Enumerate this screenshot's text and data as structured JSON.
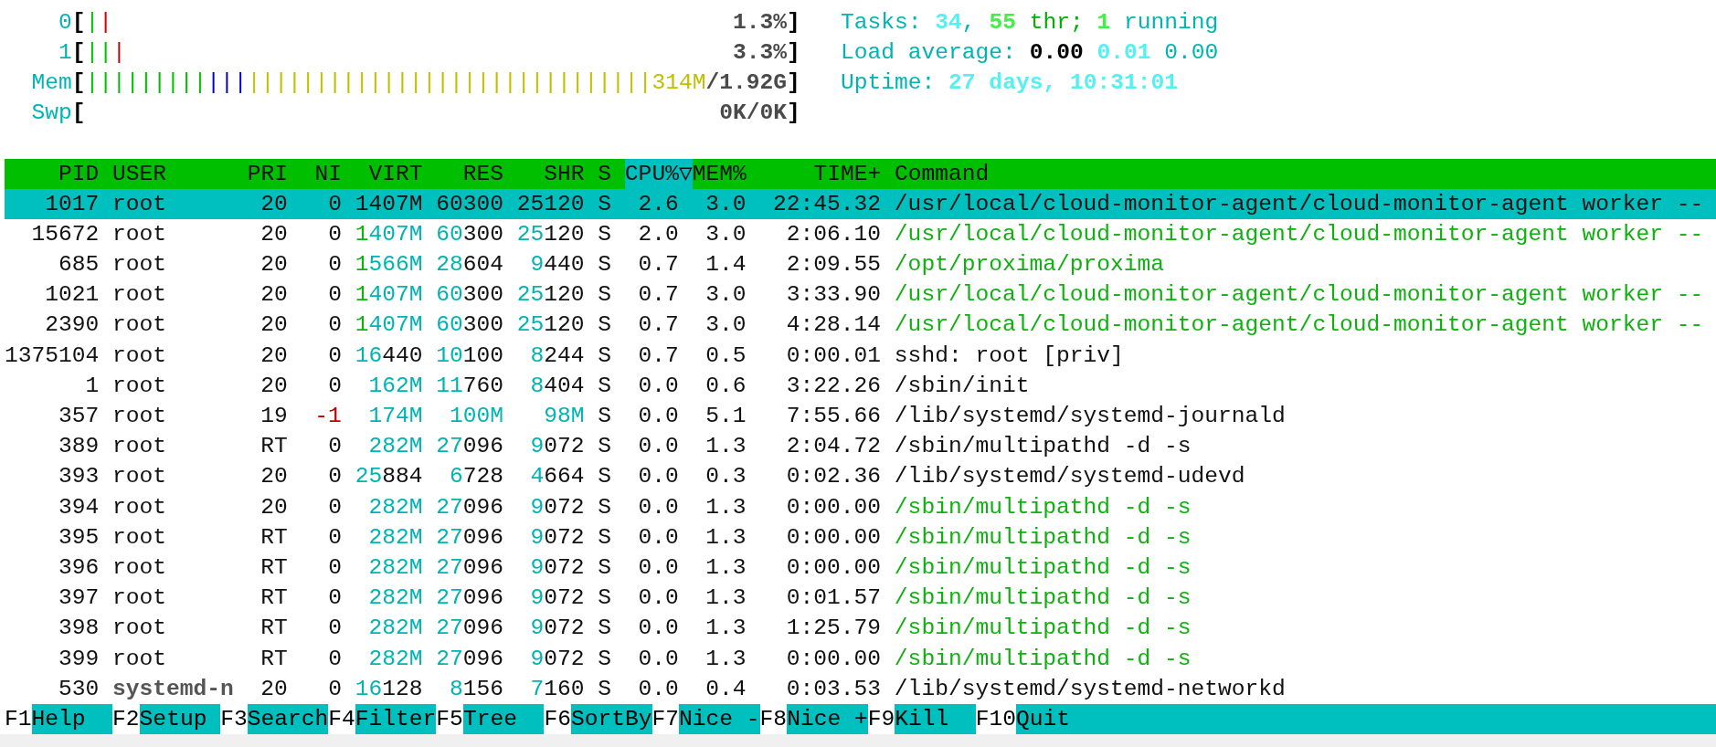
{
  "meters": [
    {
      "label": "0",
      "open": "[",
      "close": "]",
      "segments": [
        {
          "text": "|",
          "color": "#00c000"
        },
        {
          "text": "|",
          "color": "#d00000"
        }
      ],
      "value": "1.3%"
    },
    {
      "label": "1",
      "open": "[",
      "close": "]",
      "segments": [
        {
          "text": "||",
          "color": "#00c000"
        },
        {
          "text": "|",
          "color": "#d00000"
        }
      ],
      "value": "3.3%"
    },
    {
      "label": "Mem",
      "open": "[",
      "close": "]",
      "segments": [
        {
          "text": "|||||||||",
          "color": "#00c000"
        },
        {
          "text": "|||",
          "color": "#0000d0"
        },
        {
          "text": "||||||||||||||||||||||||||||||",
          "color": "#c0c000"
        }
      ],
      "value_used": "314M",
      "value": "/1.92G"
    },
    {
      "label": "Swp",
      "open": "[",
      "close": "]",
      "value": "0K/0K"
    }
  ],
  "summary": [
    [
      {
        "text": "Tasks: ",
        "color": "#00b4b4",
        "bold": false
      },
      {
        "text": "34",
        "color": "#55f0f0",
        "bold": true
      },
      {
        "text": ", ",
        "color": "#00b4b4",
        "bold": false
      },
      {
        "text": "55",
        "color": "#44ee44",
        "bold": true
      },
      {
        "text": " thr;",
        "color": "#00b000",
        "bold": false
      },
      {
        "text": " 1",
        "color": "#44ee44",
        "bold": true
      },
      {
        "text": " running",
        "color": "#00b4b4",
        "bold": false
      }
    ],
    [
      {
        "text": "Load average: ",
        "color": "#00b4b4",
        "bold": false
      },
      {
        "text": "0.00",
        "color": "#000000",
        "bold": true
      },
      {
        "text": " 0.01",
        "color": "#55f0f0",
        "bold": true
      },
      {
        "text": " 0.00",
        "color": "#00b4b4",
        "bold": false
      }
    ],
    [
      {
        "text": "Uptime: ",
        "color": "#00b4b4",
        "bold": false
      },
      {
        "text": "27 days, 10:31:01",
        "color": "#55f0f0",
        "bold": true
      }
    ]
  ],
  "columns": [
    {
      "label": "PID",
      "selected": false
    },
    {
      "label": "USER",
      "selected": false
    },
    {
      "label": "PRI",
      "selected": false
    },
    {
      "label": "NI",
      "selected": false
    },
    {
      "label": "VIRT",
      "selected": false
    },
    {
      "label": "RES",
      "selected": false
    },
    {
      "label": "SHR",
      "selected": false
    },
    {
      "label": "S",
      "selected": false
    },
    {
      "label": "CPU%▽",
      "selected": true
    },
    {
      "label": "MEM%",
      "selected": false
    },
    {
      "label": "TIME+",
      "selected": false
    },
    {
      "label": "Command",
      "selected": false
    }
  ],
  "rows": [
    {
      "pid": "1017",
      "user": "root",
      "pri": "20",
      "ni": "0",
      "virt": "1407M",
      "res": "60300",
      "shr": "25120",
      "s": "S",
      "cpu": "2.6",
      "mem": "3.0",
      "time": "22:45.32",
      "command": "/usr/local/cloud-monitor-agent/cloud-monitor-agent worker --",
      "selected": true,
      "thread": false,
      "ni_negative": false,
      "other_user": false
    },
    {
      "pid": "15672",
      "user": "root",
      "pri": "20",
      "ni": "0",
      "virt": "1407M",
      "res": "60300",
      "shr": "25120",
      "s": "S",
      "cpu": "2.0",
      "mem": "3.0",
      "time": "2:06.10",
      "command": "/usr/local/cloud-monitor-agent/cloud-monitor-agent worker --",
      "selected": false,
      "thread": true,
      "ni_negative": false,
      "other_user": false
    },
    {
      "pid": "685",
      "user": "root",
      "pri": "20",
      "ni": "0",
      "virt": "1566M",
      "res": "28604",
      "shr": "9440",
      "s": "S",
      "cpu": "0.7",
      "mem": "1.4",
      "time": "2:09.55",
      "command": "/opt/proxima/proxima",
      "selected": false,
      "thread": true,
      "ni_negative": false,
      "other_user": false
    },
    {
      "pid": "1021",
      "user": "root",
      "pri": "20",
      "ni": "0",
      "virt": "1407M",
      "res": "60300",
      "shr": "25120",
      "s": "S",
      "cpu": "0.7",
      "mem": "3.0",
      "time": "3:33.90",
      "command": "/usr/local/cloud-monitor-agent/cloud-monitor-agent worker --",
      "selected": false,
      "thread": true,
      "ni_negative": false,
      "other_user": false
    },
    {
      "pid": "2390",
      "user": "root",
      "pri": "20",
      "ni": "0",
      "virt": "1407M",
      "res": "60300",
      "shr": "25120",
      "s": "S",
      "cpu": "0.7",
      "mem": "3.0",
      "time": "4:28.14",
      "command": "/usr/local/cloud-monitor-agent/cloud-monitor-agent worker --",
      "selected": false,
      "thread": true,
      "ni_negative": false,
      "other_user": false
    },
    {
      "pid": "1375104",
      "user": "root",
      "pri": "20",
      "ni": "0",
      "virt": "16440",
      "res": "10100",
      "shr": "8244",
      "s": "S",
      "cpu": "0.7",
      "mem": "0.5",
      "time": "0:00.01",
      "command": "sshd: root [priv]",
      "selected": false,
      "thread": false,
      "ni_negative": false,
      "other_user": false
    },
    {
      "pid": "1",
      "user": "root",
      "pri": "20",
      "ni": "0",
      "virt": "162M",
      "res": "11760",
      "shr": "8404",
      "s": "S",
      "cpu": "0.0",
      "mem": "0.6",
      "time": "3:22.26",
      "command": "/sbin/init",
      "selected": false,
      "thread": false,
      "ni_negative": false,
      "other_user": false
    },
    {
      "pid": "357",
      "user": "root",
      "pri": "19",
      "ni": "-1",
      "virt": "174M",
      "res": "100M",
      "shr": "98M",
      "s": "S",
      "cpu": "0.0",
      "mem": "5.1",
      "time": "7:55.66",
      "command": "/lib/systemd/systemd-journald",
      "selected": false,
      "thread": false,
      "ni_negative": true,
      "other_user": false
    },
    {
      "pid": "389",
      "user": "root",
      "pri": "RT",
      "ni": "0",
      "virt": "282M",
      "res": "27096",
      "shr": "9072",
      "s": "S",
      "cpu": "0.0",
      "mem": "1.3",
      "time": "2:04.72",
      "command": "/sbin/multipathd -d -s",
      "selected": false,
      "thread": false,
      "ni_negative": false,
      "other_user": false
    },
    {
      "pid": "393",
      "user": "root",
      "pri": "20",
      "ni": "0",
      "virt": "25884",
      "res": "6728",
      "shr": "4664",
      "s": "S",
      "cpu": "0.0",
      "mem": "0.3",
      "time": "0:02.36",
      "command": "/lib/systemd/systemd-udevd",
      "selected": false,
      "thread": false,
      "ni_negative": false,
      "other_user": false
    },
    {
      "pid": "394",
      "user": "root",
      "pri": "20",
      "ni": "0",
      "virt": "282M",
      "res": "27096",
      "shr": "9072",
      "s": "S",
      "cpu": "0.0",
      "mem": "1.3",
      "time": "0:00.00",
      "command": "/sbin/multipathd -d -s",
      "selected": false,
      "thread": true,
      "ni_negative": false,
      "other_user": false
    },
    {
      "pid": "395",
      "user": "root",
      "pri": "RT",
      "ni": "0",
      "virt": "282M",
      "res": "27096",
      "shr": "9072",
      "s": "S",
      "cpu": "0.0",
      "mem": "1.3",
      "time": "0:00.00",
      "command": "/sbin/multipathd -d -s",
      "selected": false,
      "thread": true,
      "ni_negative": false,
      "other_user": false
    },
    {
      "pid": "396",
      "user": "root",
      "pri": "RT",
      "ni": "0",
      "virt": "282M",
      "res": "27096",
      "shr": "9072",
      "s": "S",
      "cpu": "0.0",
      "mem": "1.3",
      "time": "0:00.00",
      "command": "/sbin/multipathd -d -s",
      "selected": false,
      "thread": true,
      "ni_negative": false,
      "other_user": false
    },
    {
      "pid": "397",
      "user": "root",
      "pri": "RT",
      "ni": "0",
      "virt": "282M",
      "res": "27096",
      "shr": "9072",
      "s": "S",
      "cpu": "0.0",
      "mem": "1.3",
      "time": "0:01.57",
      "command": "/sbin/multipathd -d -s",
      "selected": false,
      "thread": true,
      "ni_negative": false,
      "other_user": false
    },
    {
      "pid": "398",
      "user": "root",
      "pri": "RT",
      "ni": "0",
      "virt": "282M",
      "res": "27096",
      "shr": "9072",
      "s": "S",
      "cpu": "0.0",
      "mem": "1.3",
      "time": "1:25.79",
      "command": "/sbin/multipathd -d -s",
      "selected": false,
      "thread": true,
      "ni_negative": false,
      "other_user": false
    },
    {
      "pid": "399",
      "user": "root",
      "pri": "RT",
      "ni": "0",
      "virt": "282M",
      "res": "27096",
      "shr": "9072",
      "s": "S",
      "cpu": "0.0",
      "mem": "1.3",
      "time": "0:00.00",
      "command": "/sbin/multipathd -d -s",
      "selected": false,
      "thread": true,
      "ni_negative": false,
      "other_user": false
    },
    {
      "pid": "530",
      "user": "systemd-n",
      "pri": "20",
      "ni": "0",
      "virt": "16128",
      "res": "8156",
      "shr": "7160",
      "s": "S",
      "cpu": "0.0",
      "mem": "0.4",
      "time": "0:03.53",
      "command": "/lib/systemd/systemd-networkd",
      "selected": false,
      "thread": false,
      "ni_negative": false,
      "other_user": true
    }
  ],
  "footer": [
    {
      "key": "F1",
      "label": "Help"
    },
    {
      "key": "F2",
      "label": "Setup"
    },
    {
      "key": "F3",
      "label": "Search"
    },
    {
      "key": "F4",
      "label": "Filter"
    },
    {
      "key": "F5",
      "label": "Tree"
    },
    {
      "key": "F6",
      "label": "SortBy"
    },
    {
      "key": "F7",
      "label": "Nice -"
    },
    {
      "key": "F8",
      "label": "Nice +"
    },
    {
      "key": "F9",
      "label": "Kill"
    },
    {
      "key": "F10",
      "label": "Quit"
    }
  ]
}
